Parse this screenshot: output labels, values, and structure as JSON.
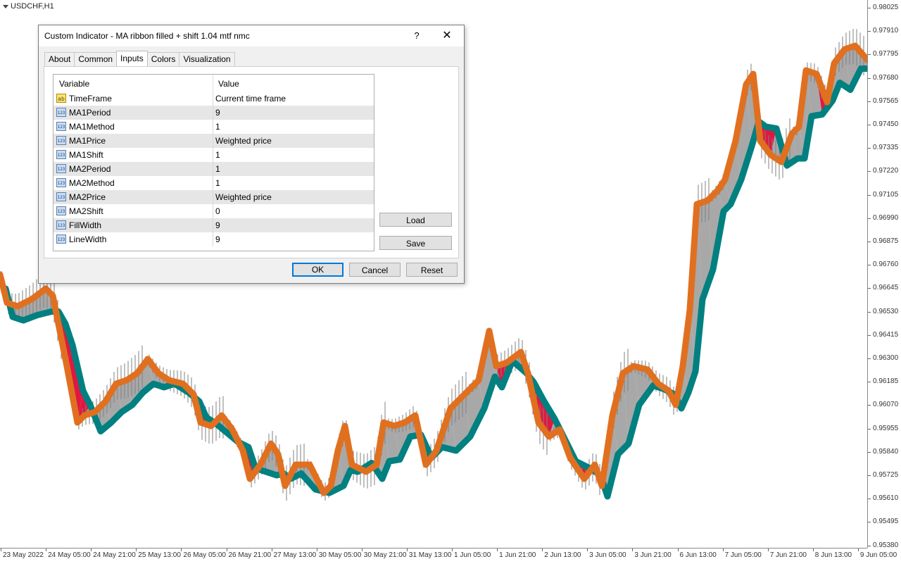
{
  "chart": {
    "symbol": "USDCHF,H1",
    "colors": {
      "background": "#ffffff",
      "candle": "#808080",
      "fast_ma": "#e07020",
      "slow_ma": "#008080",
      "fill_bear": "#e01840",
      "fill_bull": "#a8a8a8"
    }
  },
  "price_axis": [
    "0.98025",
    "0.97910",
    "0.97795",
    "0.97680",
    "0.97565",
    "0.97450",
    "0.97335",
    "0.97220",
    "0.97105",
    "0.96990",
    "0.96875",
    "0.96760",
    "0.96645",
    "0.96530",
    "0.96415",
    "0.96300",
    "0.96185",
    "0.96070",
    "0.95955",
    "0.95840",
    "0.95725",
    "0.95610",
    "0.95495",
    "0.95380"
  ],
  "time_axis": [
    "23 May 2022",
    "24 May 05:00",
    "24 May 21:00",
    "25 May 13:00",
    "26 May 05:00",
    "26 May 21:00",
    "27 May 13:00",
    "30 May 05:00",
    "30 May 21:00",
    "31 May 13:00",
    "1 Jun 05:00",
    "1 Jun 21:00",
    "2 Jun 13:00",
    "3 Jun 05:00",
    "3 Jun 21:00",
    "6 Jun 13:00",
    "7 Jun 05:00",
    "7 Jun 21:00",
    "8 Jun 13:00",
    "9 Jun 05:00"
  ],
  "dialog": {
    "title": "Custom Indicator - MA ribbon filled + shift 1.04 mtf nmc",
    "help": "?",
    "close": "✕",
    "tabs": [
      "About",
      "Common",
      "Inputs",
      "Colors",
      "Visualization"
    ],
    "active_tab": "Inputs",
    "grid_headers": {
      "variable": "Variable",
      "value": "Value"
    },
    "params": [
      {
        "type": "ab",
        "name": "TimeFrame",
        "value": "Current time frame"
      },
      {
        "type": "123",
        "name": "MA1Period",
        "value": "9"
      },
      {
        "type": "123",
        "name": "MA1Method",
        "value": "1"
      },
      {
        "type": "123",
        "name": "MA1Price",
        "value": "Weighted price"
      },
      {
        "type": "123",
        "name": "MA1Shift",
        "value": "1"
      },
      {
        "type": "123",
        "name": "MA2Period",
        "value": "1"
      },
      {
        "type": "123",
        "name": "MA2Method",
        "value": "1"
      },
      {
        "type": "123",
        "name": "MA2Price",
        "value": "Weighted price"
      },
      {
        "type": "123",
        "name": "MA2Shift",
        "value": "0"
      },
      {
        "type": "123",
        "name": "FillWidth",
        "value": "9"
      },
      {
        "type": "123",
        "name": "LineWidth",
        "value": "9"
      }
    ],
    "buttons": {
      "load": "Load",
      "save": "Save",
      "ok": "OK",
      "cancel": "Cancel",
      "reset": "Reset"
    }
  }
}
